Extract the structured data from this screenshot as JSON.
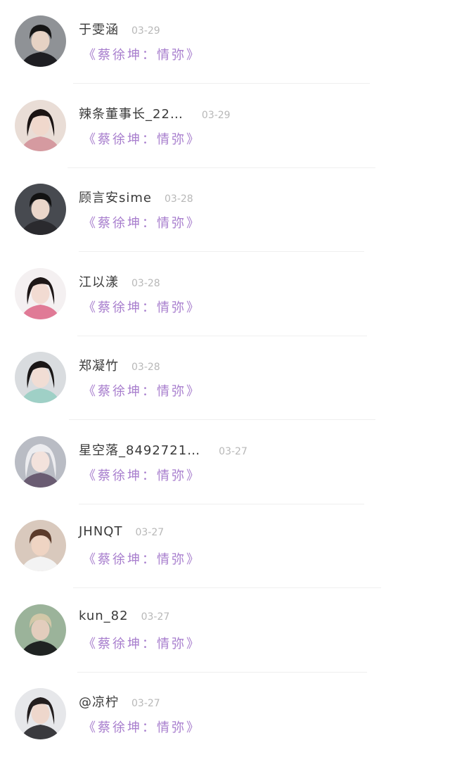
{
  "comments": [
    {
      "username": "于雯涵",
      "date": "03-29",
      "text": "《蔡徐坤：情弥》",
      "avatar": {
        "bg": "#8f9296",
        "hair": "#151515",
        "skin": "#e6d2c4",
        "cloth": "#1e1e22"
      }
    },
    {
      "username": "辣条董事长_22…",
      "date": "03-29",
      "text": "《蔡徐坤：情弥》",
      "avatar": {
        "bg": "#e9ddd6",
        "hair": "#1b1413",
        "skin": "#f0d8cc",
        "cloth": "#d59aa0"
      }
    },
    {
      "username": "顾言安sime",
      "date": "03-28",
      "text": "《蔡徐坤：情弥》",
      "avatar": {
        "bg": "#474a50",
        "hair": "#121212",
        "skin": "#ead6ca",
        "cloth": "#2a2a2e"
      }
    },
    {
      "username": "江以漾",
      "date": "03-28",
      "text": "《蔡徐坤：情弥》",
      "avatar": {
        "bg": "#f4f0f1",
        "hair": "#1e1717",
        "skin": "#f2dbd2",
        "cloth": "#e07a96"
      }
    },
    {
      "username": "郑凝竹",
      "date": "03-28",
      "text": "《蔡徐坤：情弥》",
      "avatar": {
        "bg": "#d9dcdf",
        "hair": "#1a1616",
        "skin": "#f1ddd4",
        "cloth": "#9fd0c6"
      }
    },
    {
      "username": "星空落_8492721…",
      "date": "03-27",
      "text": "《蔡徐坤：情弥》",
      "avatar": {
        "bg": "#b9bcc4",
        "hair": "#ececef",
        "skin": "#f3e2dc",
        "cloth": "#6a5c72"
      }
    },
    {
      "username": "JHNQT",
      "date": "03-27",
      "text": "《蔡徐坤：情弥》",
      "avatar": {
        "bg": "#d9c9bd",
        "hair": "#5b3a2a",
        "skin": "#efd4c3",
        "cloth": "#f3f3f3"
      }
    },
    {
      "username": "kun_82",
      "date": "03-27",
      "text": "《蔡徐坤：情弥》",
      "avatar": {
        "bg": "#9bb39a",
        "hair": "#d2c8a8",
        "skin": "#e3cdbd",
        "cloth": "#1f2322"
      }
    },
    {
      "username": "@凉柠",
      "date": "03-27",
      "text": "《蔡徐坤：情弥》",
      "avatar": {
        "bg": "#e6e7ea",
        "hair": "#231e1e",
        "skin": "#eed7cc",
        "cloth": "#3a3a3e"
      }
    }
  ]
}
